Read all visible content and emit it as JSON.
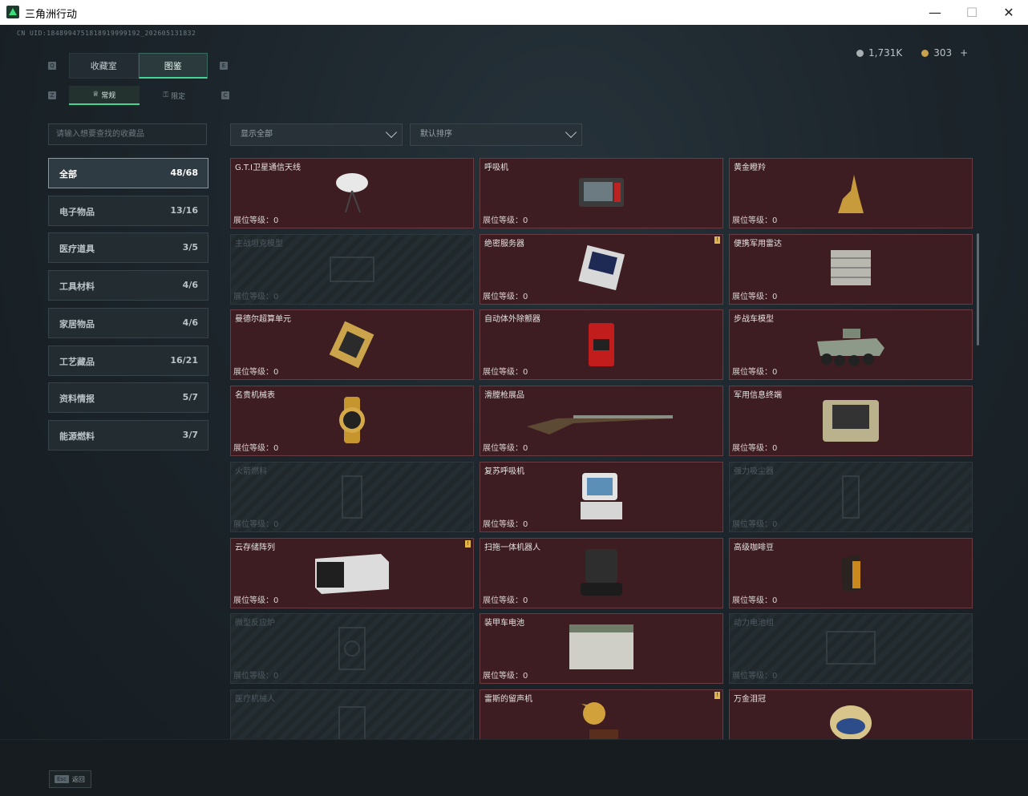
{
  "window": {
    "title": "三角洲行动"
  },
  "header": {
    "uid": "CN UID:1848994751818919999192_202605131832",
    "silver": "1,731K",
    "gold": "303",
    "plus": "+"
  },
  "tabs": {
    "collection": "收藏室",
    "gallery": "图鉴",
    "normal": "常规",
    "limited": "限定"
  },
  "keys": {
    "q": "Q",
    "e": "E",
    "z": "Z",
    "c": "C"
  },
  "search": {
    "placeholder": "请输入想要查找的收藏品"
  },
  "filters": {
    "show": "显示全部",
    "sort": "默认排序"
  },
  "categories": [
    {
      "name": "全部",
      "count": "48/68"
    },
    {
      "name": "电子物品",
      "count": "13/16"
    },
    {
      "name": "医疗道具",
      "count": "3/5"
    },
    {
      "name": "工具材料",
      "count": "4/6"
    },
    {
      "name": "家居物品",
      "count": "4/6"
    },
    {
      "name": "工艺藏品",
      "count": "16/21"
    },
    {
      "name": "资料情报",
      "count": "5/7"
    },
    {
      "name": "能源燃料",
      "count": "3/7"
    }
  ],
  "level_label": "展位等级：0",
  "flag": "!",
  "items": [
    {
      "name": "G.T.I卫星通信天线",
      "unlocked": true,
      "flag": false,
      "icon": "satellite-dish-icon"
    },
    {
      "name": "呼吸机",
      "unlocked": true,
      "flag": false,
      "icon": "ventilator-icon"
    },
    {
      "name": "黄金瞪羚",
      "unlocked": true,
      "flag": false,
      "icon": "golden-gazelle-icon"
    },
    {
      "name": "主战坦克模型",
      "unlocked": false,
      "flag": false,
      "icon": "tank-model-icon"
    },
    {
      "name": "绝密服务器",
      "unlocked": true,
      "flag": true,
      "icon": "server-icon"
    },
    {
      "name": "便携军用雷达",
      "unlocked": true,
      "flag": false,
      "icon": "radar-icon"
    },
    {
      "name": "曼德尔超算单元",
      "unlocked": true,
      "flag": false,
      "icon": "cpu-unit-icon"
    },
    {
      "name": "自动体外除颤器",
      "unlocked": true,
      "flag": false,
      "icon": "defibrillator-icon"
    },
    {
      "name": "步战车模型",
      "unlocked": true,
      "flag": false,
      "icon": "ifv-model-icon"
    },
    {
      "name": "名贵机械表",
      "unlocked": true,
      "flag": false,
      "icon": "watch-icon"
    },
    {
      "name": "滑膛枪展品",
      "unlocked": true,
      "flag": false,
      "icon": "musket-icon"
    },
    {
      "name": "军用信息终端",
      "unlocked": true,
      "flag": false,
      "icon": "terminal-case-icon"
    },
    {
      "name": "火箭燃料",
      "unlocked": false,
      "flag": false,
      "icon": "rocket-fuel-icon"
    },
    {
      "name": "复苏呼吸机",
      "unlocked": true,
      "flag": false,
      "icon": "resuscitator-icon"
    },
    {
      "name": "强力吸尘器",
      "unlocked": false,
      "flag": false,
      "icon": "vacuum-icon"
    },
    {
      "name": "云存储阵列",
      "unlocked": true,
      "flag": true,
      "icon": "storage-array-icon"
    },
    {
      "name": "扫拖一体机器人",
      "unlocked": true,
      "flag": false,
      "icon": "robot-vacuum-icon"
    },
    {
      "name": "高级咖啡豆",
      "unlocked": true,
      "flag": false,
      "icon": "coffee-bag-icon"
    },
    {
      "name": "微型反应炉",
      "unlocked": false,
      "flag": false,
      "icon": "reactor-icon"
    },
    {
      "name": "装甲车电池",
      "unlocked": true,
      "flag": false,
      "icon": "battery-icon"
    },
    {
      "name": "动力电池组",
      "unlocked": false,
      "flag": false,
      "icon": "battery-pack-icon"
    },
    {
      "name": "医疗机械人",
      "unlocked": false,
      "flag": false,
      "icon": "medical-robot-icon"
    },
    {
      "name": "雷斯的留声机",
      "unlocked": true,
      "flag": true,
      "icon": "gramophone-icon"
    },
    {
      "name": "万金泪冠",
      "unlocked": true,
      "flag": false,
      "icon": "jeweled-crown-icon"
    }
  ],
  "footer": {
    "esc_key": "Esc",
    "esc_label": "返回"
  }
}
